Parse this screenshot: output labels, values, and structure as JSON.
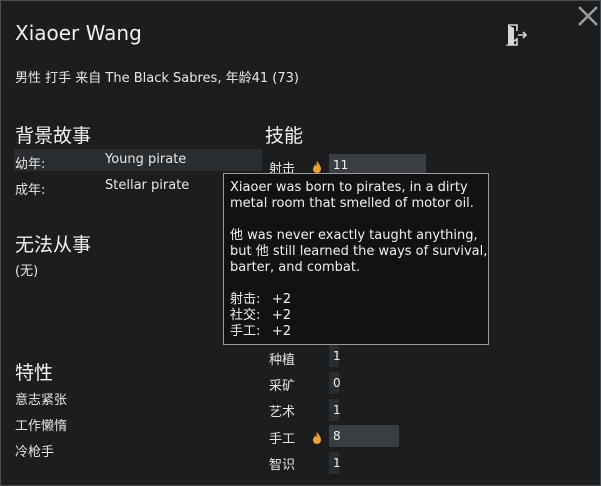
{
  "pawn": {
    "name": "Xiaoer Wang",
    "description": "男性 打手 来自 The Black Sabres, 年龄41 (73)"
  },
  "backstory": {
    "heading": "背景故事",
    "rows": [
      {
        "label": "幼年:",
        "value": "Young pirate"
      },
      {
        "label": "成年:",
        "value": "Stellar pirate"
      }
    ]
  },
  "incapable": {
    "heading": "无法从事",
    "value": "(无)"
  },
  "traits": {
    "heading": "特性",
    "items": [
      "意志紧张",
      "工作懒惰",
      "冷枪手"
    ]
  },
  "skills": {
    "heading": "技能",
    "items": [
      {
        "label": "射击",
        "value": "11",
        "level": 11,
        "passion": true
      },
      {
        "label": "种植",
        "value": "1",
        "level": 1,
        "passion": false
      },
      {
        "label": "采矿",
        "value": "0",
        "level": 0,
        "passion": false
      },
      {
        "label": "艺术",
        "value": "1",
        "level": 1,
        "passion": false
      },
      {
        "label": "手工",
        "value": "8",
        "level": 8,
        "passion": true
      },
      {
        "label": "智识",
        "value": "1",
        "level": 1,
        "passion": false
      }
    ]
  },
  "tooltip": {
    "lines1": [
      "Xiaoer was born to pirates, in a dirty",
      "metal room that smelled of motor oil."
    ],
    "lines2": [
      "他 was never exactly taught anything,",
      "but 他 still learned the ways of survival,",
      "barter, and combat."
    ],
    "bonuses": [
      {
        "skill": "射击:",
        "value": "+2"
      },
      {
        "skill": "社交:",
        "value": "+2"
      },
      {
        "skill": "手工:",
        "value": "+2"
      }
    ]
  },
  "colors": {
    "background": "#1b1d1f",
    "row_highlight": "#2a2d30",
    "tooltip_border": "#9a9a9a",
    "passion_flame": "#f0a030"
  },
  "icons": {
    "close": "close-x-icon",
    "export": "door-exit-icon",
    "passion": "flame-icon"
  }
}
